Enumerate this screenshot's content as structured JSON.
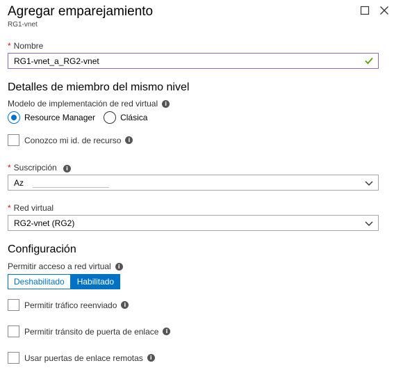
{
  "header": {
    "title": "Agregar emparejamiento",
    "subtitle": "RG1-vnet"
  },
  "name_field": {
    "label": "Nombre",
    "value": "RG1-vnet_a_RG2-vnet"
  },
  "peer_details": {
    "heading": "Detalles de miembro del mismo nivel",
    "deployment_model_label": "Modelo de implementación de red virtual",
    "options": [
      "Resource Manager",
      "Clásica"
    ],
    "selected": "Resource Manager",
    "resource_id_checkbox": "Conozco mi id. de recurso"
  },
  "subscription": {
    "label": "Suscripción",
    "value": "Az"
  },
  "virtual_network": {
    "label": "Red virtual",
    "value": "RG2-vnet (RG2)"
  },
  "configuration": {
    "heading": "Configuración",
    "access_label": "Permitir acceso a red virtual",
    "toggle_options": [
      "Deshabilitado",
      "Habilitado"
    ],
    "toggle_selected": "Habilitado",
    "checkboxes": [
      "Permitir tráfico reenviado",
      "Permitir tránsito de puerta de enlace",
      "Usar puertas de enlace remotas"
    ]
  },
  "colors": {
    "accent": "#0072c6",
    "required": "#e00b1c",
    "valid_check": "#57a300"
  }
}
